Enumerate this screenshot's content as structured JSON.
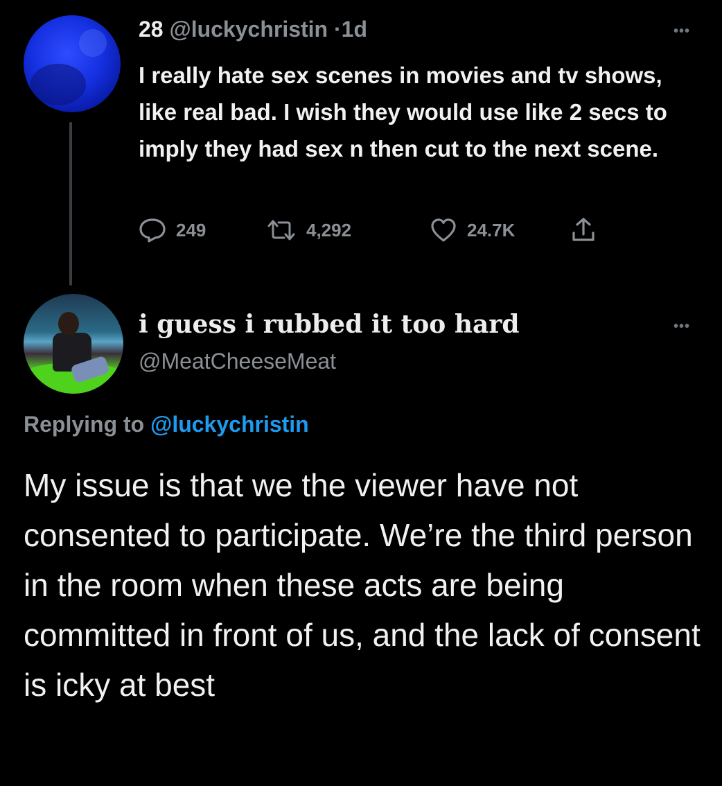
{
  "parent_tweet": {
    "display_name": "28",
    "handle": "@luckychristin",
    "separator": "·",
    "time": "1d",
    "more_icon": "more-horizontal-icon",
    "text": "I really hate sex scenes in movies and tv shows, like real bad. I wish they would use like 2 secs to imply they had sex n then cut to the next scene.",
    "metrics": {
      "replies": "249",
      "retweets": "4,292",
      "likes": "24.7K"
    },
    "icons": {
      "reply": "reply-icon",
      "retweet": "retweet-icon",
      "like": "heart-icon",
      "share": "share-icon"
    }
  },
  "reply_tweet": {
    "display_name": "i guess i rubbed it too hard",
    "handle": "@MeatCheeseMeat",
    "more_icon": "more-horizontal-icon",
    "replying_prefix": "Replying to",
    "replying_to": "@luckychristin",
    "text": "My issue is that we the viewer have not consented to participate. We’re the third person in the room when these acts are being committed in front of us, and the lack of consent is icky at best"
  },
  "colors": {
    "background": "#000000",
    "primary_text": "#e7e9ea",
    "secondary_text": "#8b9096",
    "link": "#1d9bf0"
  }
}
